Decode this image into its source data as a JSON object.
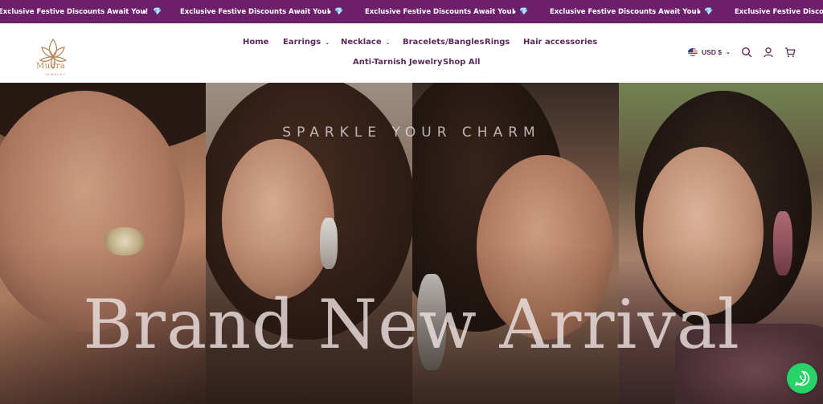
{
  "announcement": {
    "message": "Exclusive Festive Discounts Await You!",
    "diamond": "💎",
    "separator": "•",
    "bg_color": "#6d1f6b"
  },
  "brand": {
    "name": "Mudra",
    "sub": "JEWELRY",
    "color": "#b8885c"
  },
  "nav": {
    "items": [
      {
        "label": "Home"
      },
      {
        "label": "Earrings",
        "has_dropdown": true
      },
      {
        "label": "Necklace",
        "has_dropdown": true
      },
      {
        "label": "Bracelets/Bangles"
      },
      {
        "label": "Rings"
      },
      {
        "label": "Hair accessories"
      },
      {
        "label": "Anti-Tarnish Jewelry"
      },
      {
        "label": "Shop All"
      }
    ],
    "chevron": "⌄",
    "color": "#5a2a5a"
  },
  "currency": {
    "label": "USD $",
    "chevron": "⌄"
  },
  "header_icons": [
    "search-icon",
    "account-icon",
    "cart-icon"
  ],
  "hero": {
    "tagline": "SPARKLE YOUR CHARM",
    "headline": "Brand New Arrival"
  },
  "chat": {
    "icon": "whatsapp-icon",
    "color": "#25d366"
  }
}
